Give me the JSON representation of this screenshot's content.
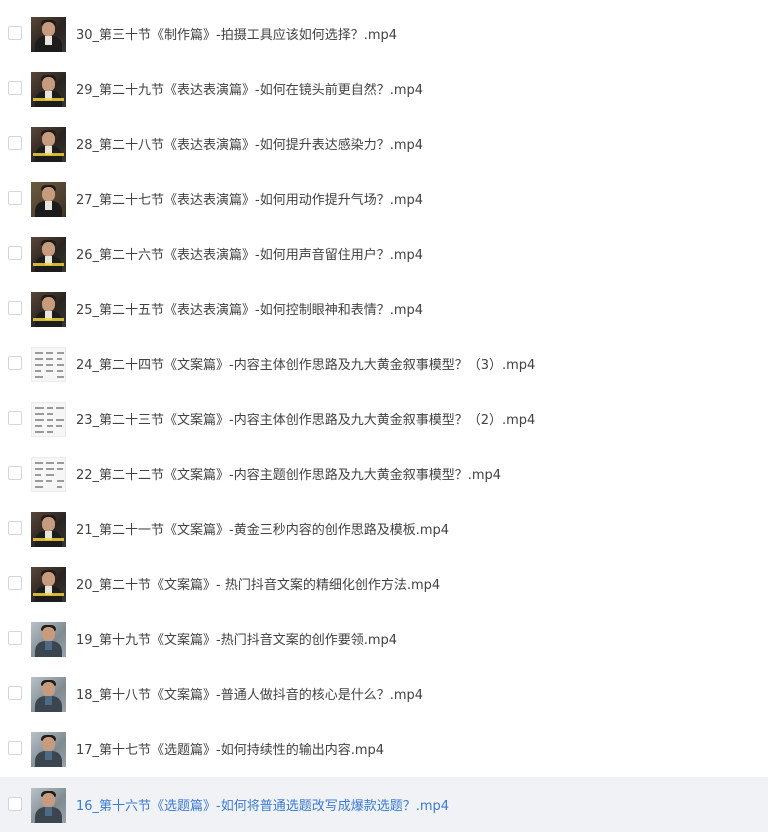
{
  "file_list": {
    "items": [
      {
        "label": "30_第三十节《制作篇》-拍摄工具应该如何选择？.mp4",
        "thumbnail": "video-thumbnail"
      },
      {
        "label": "29_第二十九节《表达表演篇》-如何在镜头前更自然？.mp4",
        "thumbnail": "video-thumbnail"
      },
      {
        "label": "28_第二十八节《表达表演篇》-如何提升表达感染力？.mp4",
        "thumbnail": "video-thumbnail"
      },
      {
        "label": "27_第二十七节《表达表演篇》-如何用动作提升气场？.mp4",
        "thumbnail": "video-thumbnail"
      },
      {
        "label": "26_第二十六节《表达表演篇》-如何用声音留住用户？.mp4",
        "thumbnail": "video-thumbnail"
      },
      {
        "label": "25_第二十五节《表达表演篇》-如何控制眼神和表情？.mp4",
        "thumbnail": "video-thumbnail"
      },
      {
        "label": "24_第二十四节《文案篇》-内容主体创作思路及九大黄金叙事模型？（3）.mp4",
        "thumbnail": "document-thumbnail"
      },
      {
        "label": "23_第二十三节《文案篇》-内容主体创作思路及九大黄金叙事模型？（2）.mp4",
        "thumbnail": "document-thumbnail"
      },
      {
        "label": "22_第二十二节《文案篇》-内容主题创作思路及九大黄金叙事模型？.mp4",
        "thumbnail": "document-thumbnail"
      },
      {
        "label": "21_第二十一节《文案篇》-黄金三秒内容的创作思路及模板.mp4",
        "thumbnail": "video-thumbnail"
      },
      {
        "label": "20_第二十节《文案篇》- 热门抖音文案的精细化创作方法.mp4",
        "thumbnail": "video-thumbnail"
      },
      {
        "label": "19_第十九节《文案篇》-热门抖音文案的创作要领.mp4",
        "thumbnail": "video-thumbnail"
      },
      {
        "label": "18_第十八节《文案篇》-普通人做抖音的核心是什么？.mp4",
        "thumbnail": "video-thumbnail"
      },
      {
        "label": "17_第十七节《选题篇》-如何持续性的输出内容.mp4",
        "thumbnail": "video-thumbnail"
      },
      {
        "label": "16_第十六节《选题篇》-如何将普通选题改写成爆款选题？.mp4",
        "thumbnail": "video-thumbnail"
      }
    ],
    "highlighted_index": 14,
    "colors": {
      "text": "#424242",
      "highlight_text": "#3a7bd5",
      "highlight_bg": "#f0f2f5",
      "checkbox_border": "#d3d6dc"
    }
  }
}
